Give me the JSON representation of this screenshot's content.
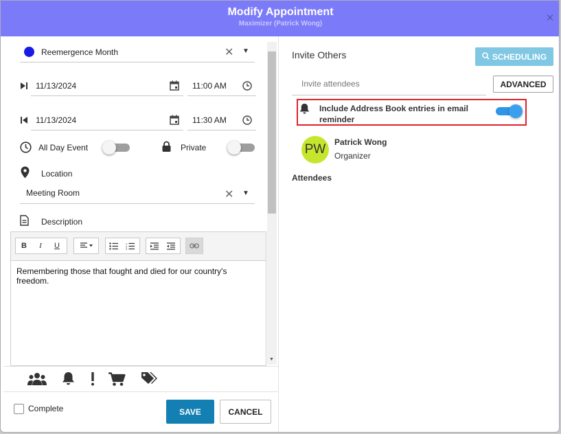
{
  "dialog": {
    "title": "Modify Appointment",
    "subtitle": "Maximizer (Patrick Wong)",
    "close_icon": "close-icon"
  },
  "form": {
    "category": {
      "value": "Reemergence Month",
      "color": "#1a1ae6"
    },
    "start": {
      "date": "11/13/2024",
      "time": "11:00 AM"
    },
    "end": {
      "date": "11/13/2024",
      "time": "11:30 AM"
    },
    "all_day": {
      "label": "All Day Event",
      "on": false
    },
    "private": {
      "label": "Private",
      "on": false
    },
    "location": {
      "label": "Location",
      "value": "Meeting Room"
    },
    "description": {
      "label": "Description",
      "text": "Remembering those that fought and died for our country's freedom."
    },
    "toolbar": {
      "bold": "B",
      "italic": "I",
      "underline": "U"
    },
    "bottom_icons": [
      "attendees-icon",
      "bell-icon",
      "priority-icon",
      "cart-icon",
      "tags-icon"
    ],
    "complete_label": "Complete",
    "save_label": "SAVE",
    "cancel_label": "CANCEL"
  },
  "invite": {
    "heading": "Invite Others",
    "scheduling_label": "SCHEDULING",
    "input_placeholder": "Invite attendees",
    "advanced_label": "ADVANCED",
    "address_book": {
      "label": "Include Address Book entries in email reminder",
      "on": true
    },
    "organizer": {
      "initials": "PW",
      "name": "Patrick Wong",
      "role": "Organizer"
    },
    "attendees_heading": "Attendees"
  },
  "colors": {
    "header": "#7b7bf9",
    "save": "#137fb3",
    "scheduling": "#7fc7e3",
    "toggle_on": "#2f95e6",
    "avatar": "#c5e62c",
    "highlight": "#e0202a"
  }
}
